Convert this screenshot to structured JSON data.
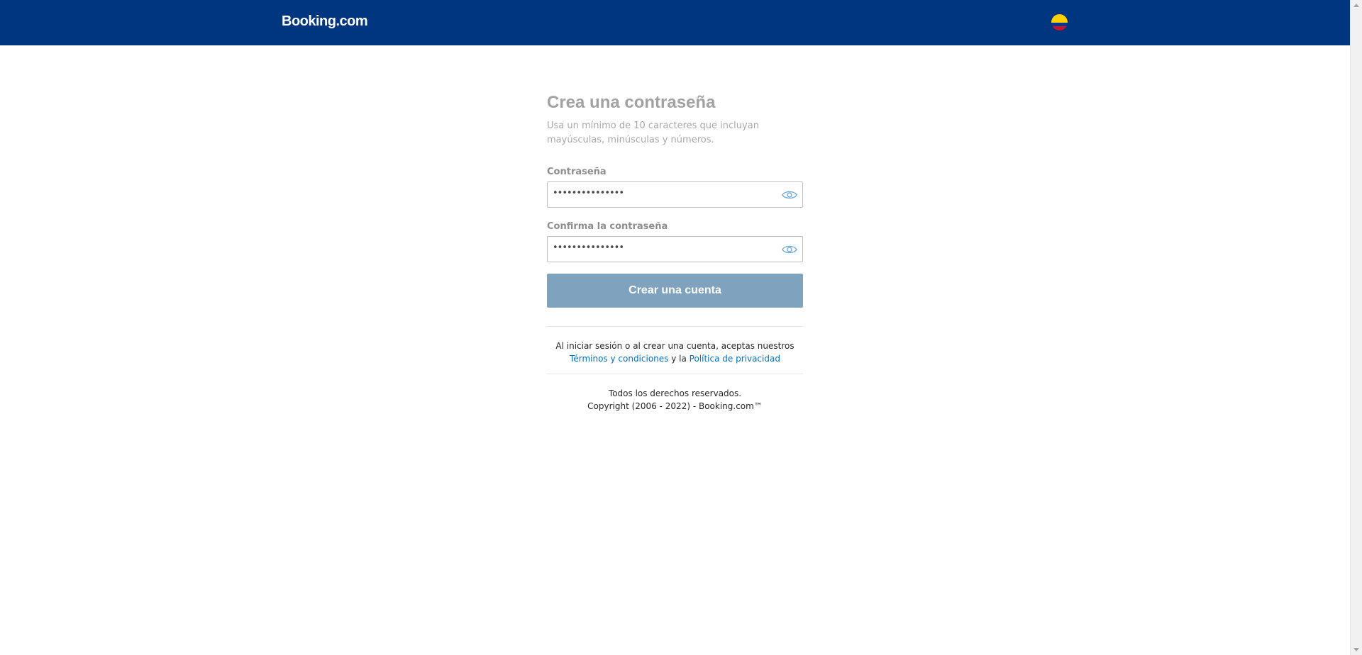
{
  "header": {
    "logo_text": "Booking.com",
    "flag_name": "colombia-flag-icon",
    "bg_color": "#003580"
  },
  "form": {
    "title": "Crea una contraseña",
    "subtitle": "Usa un mínimo de 10 caracteres que incluyan mayúsculas, minúsculas y números.",
    "password_label": "Contraseña",
    "password_value": "•••••••••••••••",
    "confirm_label": "Confirma la contraseña",
    "confirm_value": "•••••••••••••••",
    "submit_label": "Crear una cuenta",
    "submit_color": "#7fa3bf"
  },
  "terms": {
    "prefix": "Al iniciar sesión o al crear una cuenta, aceptas nuestros ",
    "terms_link": "Términos y condiciones",
    "middle": " y la ",
    "privacy_link": "Política de privacidad",
    "link_color": "#0071c2"
  },
  "footer": {
    "line1": "Todos los derechos reservados.",
    "line2": "Copyright (2006 - 2022) - Booking.com™"
  }
}
